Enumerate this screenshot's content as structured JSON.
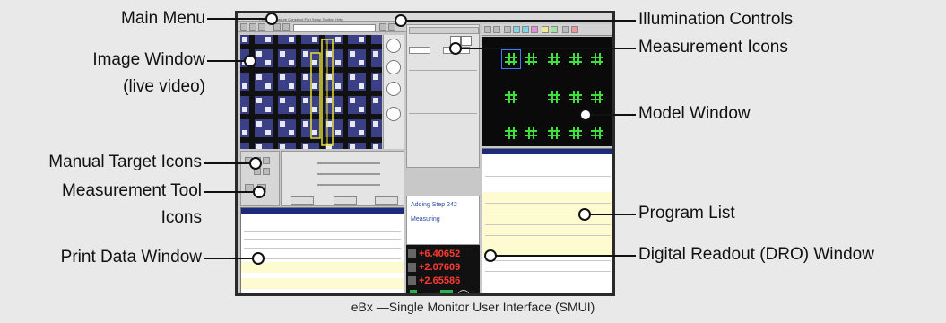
{
  "labels_left": {
    "main_menu": "Main Menu",
    "image_window_line1": "Image Window",
    "image_window_line2": "(live video)",
    "manual_target_icons": "Manual Target Icons",
    "measurement_tool_line1": "Measurement Tool",
    "measurement_tool_line2": "Icons",
    "print_data_window": "Print Data Window"
  },
  "labels_right": {
    "illumination_controls": "Illumination Controls",
    "measurement_icons": "Measurement Icons",
    "model_window": "Model Window",
    "program_list": "Program List",
    "dro_window": "Digital Readout (DRO) Window"
  },
  "caption": "eBx —Single Monitor User Interface (SMUI)",
  "screenshot": {
    "step_text": "Adding Step 242",
    "status_text": "Measuring",
    "dro_values": [
      "+6.40652",
      "+2.07609",
      "+2.65586"
    ],
    "colors": {
      "dro_text": "#ff3b30",
      "model_cross": "#3de03d",
      "title_bar": "#1b2a7a"
    }
  }
}
